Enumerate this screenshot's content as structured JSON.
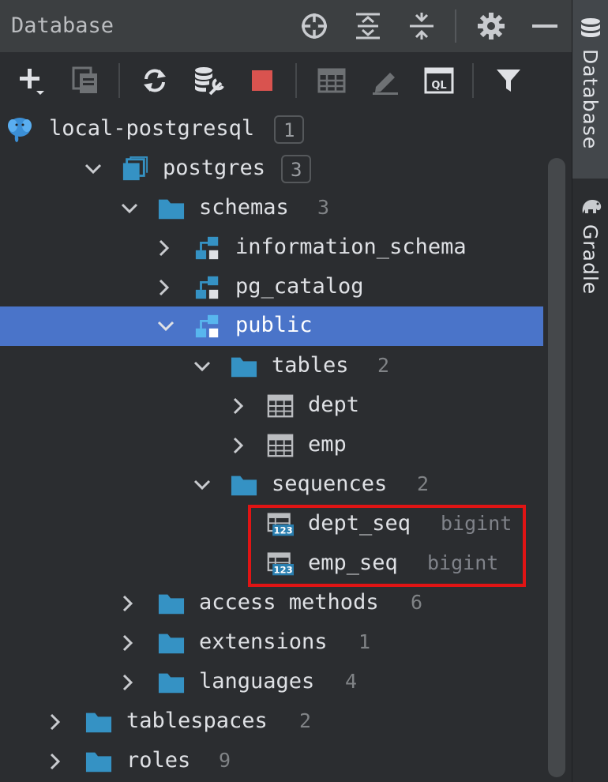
{
  "header": {
    "title": "Database"
  },
  "sidebar": {
    "database_label": "Database",
    "gradle_label": "Gradle"
  },
  "tree": {
    "connection": {
      "label": "local-postgresql",
      "count": "1"
    },
    "database": {
      "label": "postgres",
      "count": "3"
    },
    "schemas": {
      "label": "schemas",
      "count": "3"
    },
    "information_schema": {
      "label": "information_schema"
    },
    "pg_catalog": {
      "label": "pg_catalog"
    },
    "public": {
      "label": "public"
    },
    "tables": {
      "label": "tables",
      "count": "2"
    },
    "dept": {
      "label": "dept"
    },
    "emp": {
      "label": "emp"
    },
    "sequences": {
      "label": "sequences",
      "count": "2"
    },
    "dept_seq": {
      "label": "dept_seq",
      "type": "bigint"
    },
    "emp_seq": {
      "label": "emp_seq",
      "type": "bigint"
    },
    "access_methods": {
      "label": "access methods",
      "count": "6"
    },
    "extensions": {
      "label": "extensions",
      "count": "1"
    },
    "languages": {
      "label": "languages",
      "count": "4"
    },
    "tablespaces": {
      "label": "tablespaces",
      "count": "2"
    },
    "roles": {
      "label": "roles",
      "count": "9"
    }
  },
  "icons": {
    "header": [
      "crosshair-icon",
      "expand-all-icon",
      "collapse-all-icon",
      "gear-icon",
      "minimize-icon"
    ],
    "toolbar": [
      "add-icon",
      "duplicate-icon",
      "refresh-icon",
      "data-source-properties-icon",
      "stop-icon",
      "table-editor-icon",
      "edit-icon",
      "query-console-icon",
      "filter-icon"
    ]
  },
  "colors": {
    "selection": "#4a74c9",
    "folder": "#3592c4",
    "highlight_box": "#e01414",
    "stop": "#d9534f"
  }
}
